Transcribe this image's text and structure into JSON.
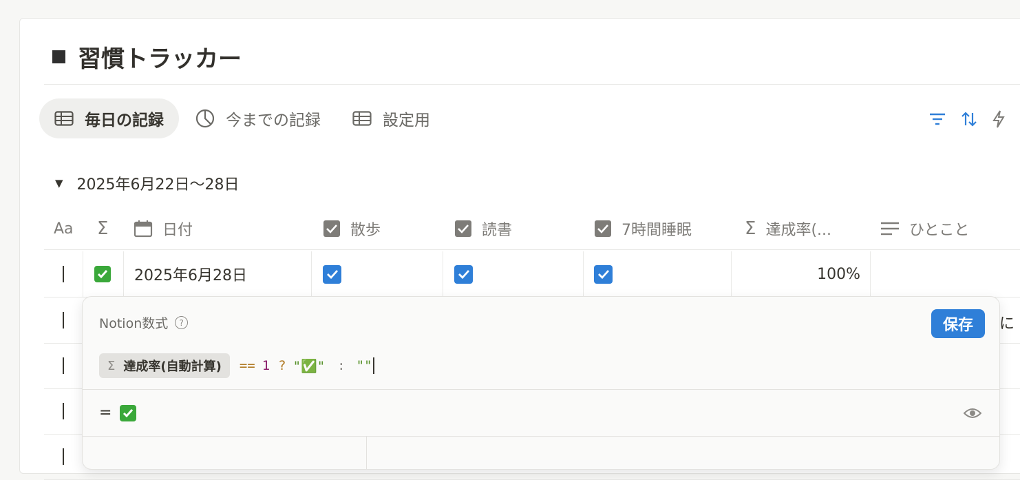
{
  "page": {
    "title": "習慣トラッカー"
  },
  "tabs": [
    {
      "label": "毎日の記録",
      "icon": "table-icon",
      "active": true
    },
    {
      "label": "今までの記録",
      "icon": "pie-chart-icon",
      "active": false
    },
    {
      "label": "設定用",
      "icon": "table-icon",
      "active": false
    }
  ],
  "toolbar": {
    "icons": [
      "filter-icon",
      "sort-icon",
      "lightning-icon"
    ],
    "accent": "#2f7fd8"
  },
  "group": {
    "label": "2025年6月22日〜28日"
  },
  "table": {
    "columns": [
      {
        "label": "",
        "icon": "title-aa-icon",
        "icon_text": "Aa"
      },
      {
        "label": "",
        "icon": "formula-sigma-icon",
        "icon_text": "Σ"
      },
      {
        "label": "日付",
        "icon": "calendar-icon"
      },
      {
        "label": "散歩",
        "icon": "checkbox-icon"
      },
      {
        "label": "読書",
        "icon": "checkbox-icon"
      },
      {
        "label": "7時間睡眠",
        "icon": "checkbox-icon"
      },
      {
        "label": "達成率(...",
        "icon": "formula-sigma-icon",
        "icon_text": "Σ"
      },
      {
        "label": "ひとこと",
        "icon": "text-lines-icon"
      }
    ],
    "rows": [
      {
        "formula": "✅",
        "date": "2025年6月28日",
        "walk": true,
        "reading": true,
        "sleep": true,
        "rate": "100%",
        "note": ""
      }
    ],
    "overflow_text": "に"
  },
  "formula_editor": {
    "title": "Notion数式",
    "help": "?",
    "save_label": "保存",
    "formula": {
      "chip_icon": "Σ",
      "chip_label": "達成率(自動計算)",
      "op": "==",
      "number": "1",
      "ternary": "?",
      "true_value": "\"✅\"",
      "colon": ":",
      "false_value": "\"\""
    },
    "result_prefix": "=",
    "result_value": "✅"
  }
}
